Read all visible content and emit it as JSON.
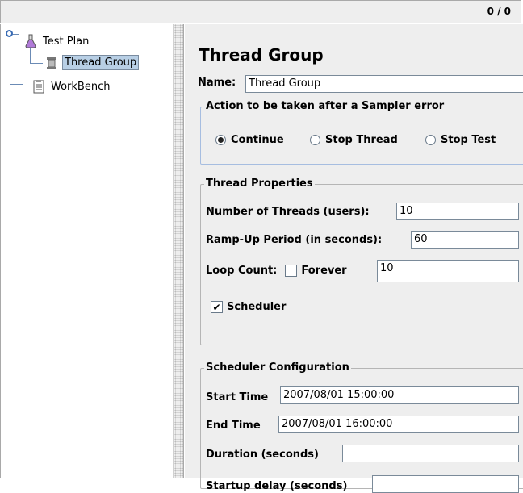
{
  "toolbar": {
    "counter": "0 / 0"
  },
  "tree": {
    "items": [
      {
        "label": "Test Plan",
        "icon": "flask-icon"
      },
      {
        "label": "Thread Group",
        "icon": "spool-icon",
        "selected": true
      },
      {
        "label": "WorkBench",
        "icon": "clipboard-icon"
      }
    ]
  },
  "panel": {
    "title": "Thread Group",
    "name_label": "Name:",
    "name_value": "Thread Group",
    "error_group": {
      "legend": "Action to be taken after a Sampler error",
      "options": [
        "Continue",
        "Stop Thread",
        "Stop Test"
      ],
      "selected": "Continue"
    },
    "thread_props": {
      "legend": "Thread Properties",
      "threads_label": "Number of Threads (users):",
      "threads_value": "10",
      "rampup_label": "Ramp-Up Period (in seconds):",
      "rampup_value": "60",
      "loop_label": "Loop Count:",
      "forever_label": "Forever",
      "forever_checked": false,
      "loop_value": "10",
      "scheduler_label": "Scheduler",
      "scheduler_checked": true
    },
    "scheduler_config": {
      "legend": "Scheduler Configuration",
      "start_label": "Start Time",
      "start_value": "2007/08/01 15:00:00",
      "end_label": "End Time",
      "end_value": "2007/08/01 16:00:00",
      "duration_label": "Duration (seconds)",
      "duration_value": "",
      "delay_label": "Startup delay (seconds)",
      "delay_value": ""
    }
  }
}
